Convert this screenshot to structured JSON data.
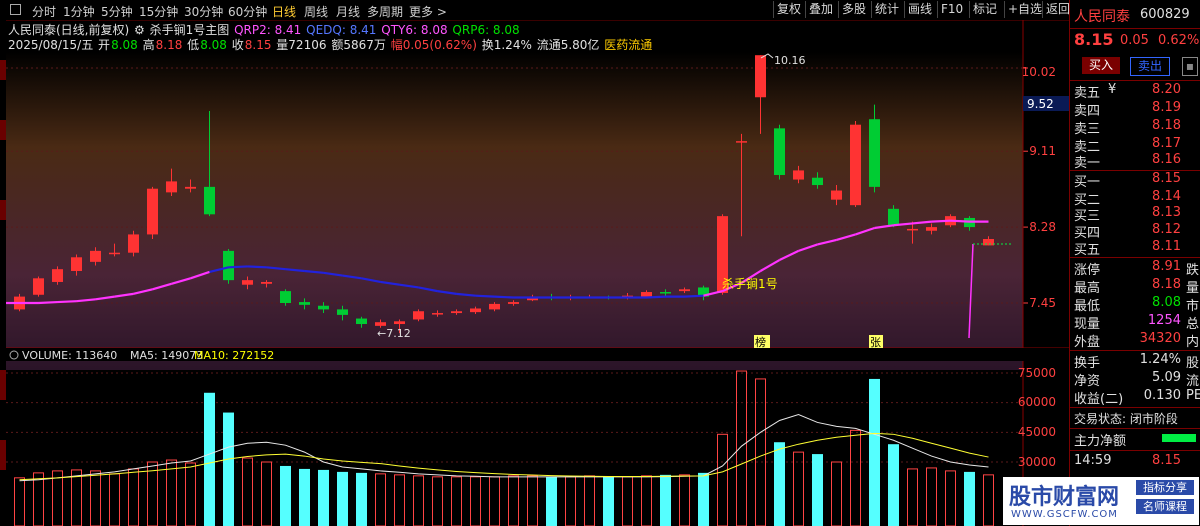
{
  "toolbar": {
    "periods": [
      "分时",
      "1分钟",
      "5分钟",
      "15分钟",
      "30分钟",
      "60分钟",
      "日线",
      "周线",
      "月线",
      "多周期",
      "更多 >"
    ],
    "active_period": "日线",
    "buttons": [
      "复权",
      "叠加",
      "多股",
      "统计",
      "画线",
      "F10",
      "标记",
      "+自选",
      "返回"
    ]
  },
  "info": {
    "stock_title": "人民同泰(日线,前复权)",
    "indicator_name": "杀手锏1号主图",
    "qrp2": "QRP2: 8.41",
    "qedq": "QEDQ: 8.41",
    "qty6": "QTY6: 8.08",
    "qrp6": "QRP6: 8.08",
    "date": "2025/08/15/五",
    "open_l": "开",
    "open": "8.08",
    "high_l": "高",
    "high": "8.18",
    "low_l": "低",
    "low": "8.08",
    "close_l": "收",
    "close": "8.15",
    "vol": "量72106",
    "amt": "额5867万",
    "chg": "幅0.05(0.62%)",
    "turnover": "换1.24%",
    "float_cap": "流通5.80亿",
    "sector": "医药流通"
  },
  "price_axis": {
    "ticks": [
      "10.02",
      "9.11",
      "8.28",
      "7.45"
    ],
    "cursor_label": "9.52"
  },
  "annotations": {
    "high": "10.16",
    "low": "←7.12",
    "indicator_label": "杀手锏1号",
    "marker1": "榜",
    "marker2": "张"
  },
  "volume_header": {
    "volume": "VOLUME: 113640",
    "ma5": "MA5: 149073",
    "ma10": "MA10: 272152"
  },
  "volume_axis": {
    "ticks": [
      "75000",
      "60000",
      "45000",
      "30000"
    ]
  },
  "colors": {
    "up": "#ff3333",
    "down": "#00cc33",
    "vol_up": "#ff4444",
    "vol_down": "#55ffff",
    "ma": "#ff33ff",
    "ma_blue": "#2222dd"
  },
  "chart_data": {
    "type": "candlestick",
    "ylim": [
      7.0,
      10.45
    ],
    "candles": [
      {
        "o": 7.38,
        "c": 7.52,
        "h": 7.55,
        "l": 7.36
      },
      {
        "o": 7.54,
        "c": 7.72,
        "h": 7.74,
        "l": 7.52
      },
      {
        "o": 7.68,
        "c": 7.82,
        "h": 7.85,
        "l": 7.65
      },
      {
        "o": 7.8,
        "c": 7.95,
        "h": 7.98,
        "l": 7.75
      },
      {
        "o": 7.9,
        "c": 8.02,
        "h": 8.06,
        "l": 7.86
      },
      {
        "o": 8.0,
        "c": 8.0,
        "h": 8.1,
        "l": 7.96
      },
      {
        "o": 8.0,
        "c": 8.2,
        "h": 8.24,
        "l": 7.96
      },
      {
        "o": 8.2,
        "c": 8.7,
        "h": 8.72,
        "l": 8.15
      },
      {
        "o": 8.66,
        "c": 8.78,
        "h": 8.92,
        "l": 8.62
      },
      {
        "o": 8.7,
        "c": 8.72,
        "h": 8.8,
        "l": 8.66
      },
      {
        "o": 8.72,
        "c": 8.42,
        "h": 9.55,
        "l": 8.4
      },
      {
        "o": 8.02,
        "c": 7.7,
        "h": 8.04,
        "l": 7.66
      },
      {
        "o": 7.65,
        "c": 7.7,
        "h": 7.74,
        "l": 7.6
      },
      {
        "o": 7.66,
        "c": 7.68,
        "h": 7.7,
        "l": 7.62
      },
      {
        "o": 7.58,
        "c": 7.45,
        "h": 7.6,
        "l": 7.42
      },
      {
        "o": 7.46,
        "c": 7.43,
        "h": 7.5,
        "l": 7.38
      },
      {
        "o": 7.42,
        "c": 7.38,
        "h": 7.46,
        "l": 7.34
      },
      {
        "o": 7.38,
        "c": 7.32,
        "h": 7.42,
        "l": 7.26
      },
      {
        "o": 7.28,
        "c": 7.22,
        "h": 7.3,
        "l": 7.18
      },
      {
        "o": 7.2,
        "c": 7.24,
        "h": 7.27,
        "l": 7.18
      },
      {
        "o": 7.22,
        "c": 7.25,
        "h": 7.27,
        "l": 7.12
      },
      {
        "o": 7.27,
        "c": 7.36,
        "h": 7.38,
        "l": 7.25
      },
      {
        "o": 7.34,
        "c": 7.34,
        "h": 7.37,
        "l": 7.3
      },
      {
        "o": 7.34,
        "c": 7.36,
        "h": 7.38,
        "l": 7.32
      },
      {
        "o": 7.35,
        "c": 7.39,
        "h": 7.41,
        "l": 7.33
      },
      {
        "o": 7.38,
        "c": 7.44,
        "h": 7.46,
        "l": 7.36
      },
      {
        "o": 7.44,
        "c": 7.46,
        "h": 7.48,
        "l": 7.42
      },
      {
        "o": 7.48,
        "c": 7.52,
        "h": 7.54,
        "l": 7.47
      },
      {
        "o": 7.52,
        "c": 7.5,
        "h": 7.55,
        "l": 7.48
      },
      {
        "o": 7.5,
        "c": 7.52,
        "h": 7.54,
        "l": 7.48
      },
      {
        "o": 7.51,
        "c": 7.52,
        "h": 7.54,
        "l": 7.5
      },
      {
        "o": 7.52,
        "c": 7.51,
        "h": 7.53,
        "l": 7.49
      },
      {
        "o": 7.51,
        "c": 7.53,
        "h": 7.56,
        "l": 7.49
      },
      {
        "o": 7.52,
        "c": 7.57,
        "h": 7.59,
        "l": 7.5
      },
      {
        "o": 7.57,
        "c": 7.56,
        "h": 7.6,
        "l": 7.53
      },
      {
        "o": 7.58,
        "c": 7.6,
        "h": 7.62,
        "l": 7.56
      },
      {
        "o": 7.62,
        "c": 7.52,
        "h": 7.64,
        "l": 7.48
      },
      {
        "o": 7.56,
        "c": 8.4,
        "h": 8.42,
        "l": 7.54
      },
      {
        "o": 9.22,
        "c": 9.22,
        "h": 9.3,
        "l": 8.18
      },
      {
        "o": 9.7,
        "c": 10.16,
        "h": 10.16,
        "l": 9.3
      },
      {
        "o": 9.36,
        "c": 8.85,
        "h": 9.4,
        "l": 8.8
      },
      {
        "o": 8.8,
        "c": 8.9,
        "h": 8.95,
        "l": 8.76
      },
      {
        "o": 8.82,
        "c": 8.74,
        "h": 8.88,
        "l": 8.7
      },
      {
        "o": 8.58,
        "c": 8.68,
        "h": 8.74,
        "l": 8.52
      },
      {
        "o": 8.52,
        "c": 9.4,
        "h": 9.44,
        "l": 8.5
      },
      {
        "o": 9.46,
        "c": 8.72,
        "h": 9.62,
        "l": 8.66
      },
      {
        "o": 8.48,
        "c": 8.3,
        "h": 8.52,
        "l": 8.28
      },
      {
        "o": 8.26,
        "c": 8.26,
        "h": 8.34,
        "l": 8.1
      },
      {
        "o": 8.24,
        "c": 8.28,
        "h": 8.32,
        "l": 8.2
      },
      {
        "o": 8.3,
        "c": 8.4,
        "h": 8.42,
        "l": 8.28
      },
      {
        "o": 8.38,
        "c": 8.28,
        "h": 8.4,
        "l": 8.24
      },
      {
        "o": 8.08,
        "c": 8.15,
        "h": 8.18,
        "l": 8.08
      }
    ],
    "ma_line": [
      7.45,
      7.45,
      7.46,
      7.47,
      7.49,
      7.52,
      7.55,
      7.6,
      7.66,
      7.72,
      7.79,
      7.84,
      7.85,
      7.84,
      7.82,
      7.8,
      7.78,
      7.75,
      7.72,
      7.68,
      7.65,
      7.62,
      7.58,
      7.55,
      7.53,
      7.52,
      7.51,
      7.51,
      7.51,
      7.51,
      7.51,
      7.51,
      7.51,
      7.51,
      7.52,
      7.52,
      7.53,
      7.58,
      7.67,
      7.8,
      7.92,
      8.02,
      8.09,
      8.14,
      8.2,
      8.27,
      8.3,
      8.32,
      8.34,
      8.35,
      8.34,
      8.34
    ],
    "volume_ylim": [
      20000,
      78000
    ],
    "volume": [
      22000,
      24500,
      25500,
      26000,
      25500,
      24000,
      26500,
      30000,
      31000,
      29500,
      65000,
      55000,
      32000,
      30000,
      28000,
      26500,
      26000,
      25000,
      24500,
      24000,
      23500,
      23000,
      22500,
      22500,
      22500,
      22500,
      23000,
      23000,
      22500,
      22500,
      23000,
      22500,
      22500,
      23000,
      23500,
      23500,
      24500,
      44000,
      76000,
      72000,
      40000,
      35000,
      34000,
      30000,
      46000,
      72000,
      39000,
      26500,
      27000,
      25500,
      25000,
      23500
    ],
    "vol_ma5": [
      20500,
      21000,
      22000,
      23000,
      24000,
      25000,
      26500,
      28000,
      29500,
      30500,
      34000,
      37500,
      39500,
      40000,
      38500,
      35000,
      30000,
      27500,
      26500,
      25500,
      24800,
      24000,
      23500,
      23000,
      22800,
      22500,
      22500,
      22500,
      22500,
      22500,
      22500,
      22500,
      22500,
      22500,
      22600,
      22800,
      23000,
      28000,
      38000,
      45000,
      51000,
      54000,
      50000,
      48000,
      47000,
      44000,
      41000,
      37000,
      33000,
      30000,
      28500,
      27500
    ],
    "vol_ma10": [
      21000,
      21500,
      22000,
      22600,
      23300,
      24000,
      24800,
      25600,
      26500,
      27500,
      29500,
      31500,
      32800,
      33600,
      34000,
      33000,
      31500,
      30500,
      29800,
      29200,
      28000,
      26900,
      26000,
      25200,
      24600,
      24100,
      23700,
      23400,
      23100,
      22900,
      22800,
      22700,
      22700,
      22700,
      22800,
      22900,
      23000,
      25000,
      29000,
      33000,
      36500,
      39000,
      41000,
      42500,
      43500,
      44500,
      44000,
      42000,
      39500,
      37000,
      34500,
      32500
    ]
  },
  "right_panel": {
    "name": "人民同泰",
    "code": "600829",
    "price": "8.15",
    "change": "0.05",
    "change_pct": "0.62%",
    "buy_btn": "买入",
    "sell_btn": "卖出",
    "asks": [
      {
        "label": "卖五",
        "price": "8.20",
        "mark": "¥"
      },
      {
        "label": "卖四",
        "price": "8.19"
      },
      {
        "label": "卖三",
        "price": "8.18"
      },
      {
        "label": "卖二",
        "price": "8.17"
      },
      {
        "label": "卖一",
        "price": "8.16"
      }
    ],
    "bids": [
      {
        "label": "买一",
        "price": "8.15"
      },
      {
        "label": "买二",
        "price": "8.14"
      },
      {
        "label": "买三",
        "price": "8.13"
      },
      {
        "label": "买四",
        "price": "8.12"
      },
      {
        "label": "买五",
        "price": "8.11"
      }
    ],
    "stats": [
      {
        "label": "涨停",
        "value": "8.91",
        "tail": "跌"
      },
      {
        "label": "最高",
        "value": "8.18",
        "tail": "量"
      },
      {
        "label": "最低",
        "value": "8.08",
        "tail": "市"
      },
      {
        "label": "现量",
        "value": "1254",
        "tail": "总"
      },
      {
        "label": "外盘",
        "value": "34320",
        "tail": "内"
      }
    ],
    "stats2": [
      {
        "label": "换手",
        "value": "1.24%",
        "tail": "股"
      },
      {
        "label": "净资",
        "value": "5.09",
        "tail": "流"
      },
      {
        "label": "收益(二)",
        "value": "0.130",
        "tail": "PE"
      }
    ],
    "trade_status": "交易状态: 闭市阶段",
    "main_flow": "主力净额",
    "last_time": "14:59",
    "last_price": "8.15"
  },
  "watermark": {
    "brand": "股市财富网",
    "tag1": "指标分享",
    "tag2": "名师课程",
    "url": "WWW.GSCFW.COM"
  }
}
